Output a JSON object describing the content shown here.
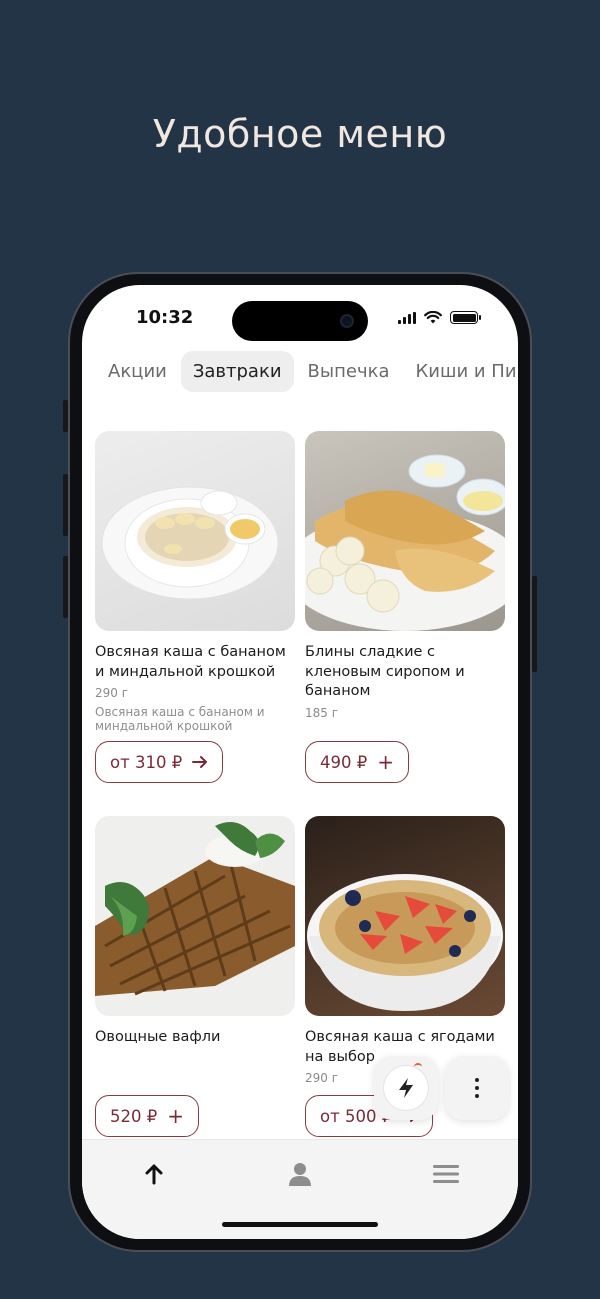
{
  "headline": "Удобное меню",
  "status_bar": {
    "time": "10:32"
  },
  "tabs": [
    {
      "label": "Акции",
      "active": false
    },
    {
      "label": "Завтраки",
      "active": true
    },
    {
      "label": "Выпечка",
      "active": false
    },
    {
      "label": "Киши и Пир",
      "active": false
    }
  ],
  "products": [
    {
      "name": "Овсяная каша с бананом и миндальной крошкой",
      "weight": "290 г",
      "description": "Овсяная каша с бананом и миндальной крошкой",
      "price": "от 310 ₽",
      "action_icon": "arrow-right-icon"
    },
    {
      "name": "Блины сладкие с кленовым сиропом и бананом",
      "weight": "185 г",
      "description": "",
      "price": "490 ₽",
      "action_icon": "plus-icon"
    },
    {
      "name": "Овощные вафли",
      "weight": "",
      "description": "",
      "price": "520 ₽",
      "action_icon": "plus-icon"
    },
    {
      "name": "Овсяная каша с ягодами на выбор",
      "weight": "290 г",
      "description": "",
      "price": "от 500 ₽",
      "action_icon": "arrow-right-icon"
    }
  ],
  "floating_buttons": {
    "quick": "lightning-icon",
    "more": "more-vertical-icon"
  },
  "bottom_nav": [
    {
      "icon": "arrow-up-icon"
    },
    {
      "icon": "profile-icon"
    },
    {
      "icon": "menu-icon"
    }
  ],
  "colors": {
    "background": "#243447",
    "accent": "#7a2b36",
    "headline": "#efe7e0"
  }
}
